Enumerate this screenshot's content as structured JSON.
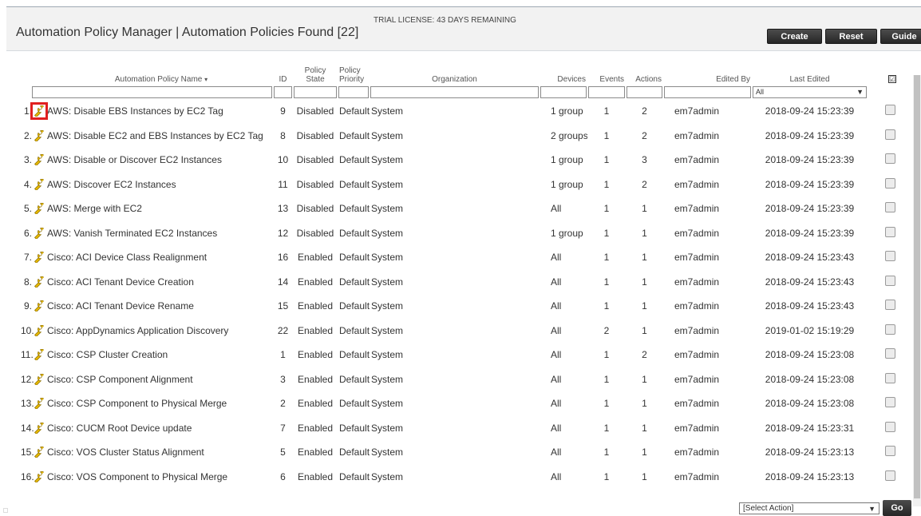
{
  "header": {
    "title": "Automation Policy Manager | Automation Policies Found [22]",
    "license": "TRIAL LICENSE: 43 DAYS REMAINING",
    "buttons": {
      "create": "Create",
      "reset": "Reset",
      "guide": "Guide"
    }
  },
  "columns": {
    "name": "Automation Policy Name",
    "name_sort": "▾",
    "id": "ID",
    "state_1": "Policy",
    "state_2": "State",
    "priority_1": "Policy",
    "priority_2": "Priority",
    "organization": "Organization",
    "devices": "Devices",
    "events": "Events",
    "actions": "Actions",
    "edited_by": "Edited By",
    "last_edited": "Last Edited",
    "select_all": "☑"
  },
  "filters": {
    "last_edited_value": "All"
  },
  "rows": [
    {
      "n": "1.",
      "name": "AWS: Disable EBS Instances by EC2 Tag",
      "id": "9",
      "state": "Disabled",
      "priority": "Default",
      "org": "System",
      "devices": "1 group",
      "events": "1",
      "actions": "2",
      "editor": "em7admin",
      "edited": "2018-09-24 15:23:39"
    },
    {
      "n": "2.",
      "name": "AWS: Disable EC2 and EBS Instances by EC2 Tag",
      "id": "8",
      "state": "Disabled",
      "priority": "Default",
      "org": "System",
      "devices": "2 groups",
      "events": "1",
      "actions": "2",
      "editor": "em7admin",
      "edited": "2018-09-24 15:23:39"
    },
    {
      "n": "3.",
      "name": "AWS: Disable or Discover EC2 Instances",
      "id": "10",
      "state": "Disabled",
      "priority": "Default",
      "org": "System",
      "devices": "1 group",
      "events": "1",
      "actions": "3",
      "editor": "em7admin",
      "edited": "2018-09-24 15:23:39"
    },
    {
      "n": "4.",
      "name": "AWS: Discover EC2 Instances",
      "id": "11",
      "state": "Disabled",
      "priority": "Default",
      "org": "System",
      "devices": "1 group",
      "events": "1",
      "actions": "2",
      "editor": "em7admin",
      "edited": "2018-09-24 15:23:39"
    },
    {
      "n": "5.",
      "name": "AWS: Merge with EC2",
      "id": "13",
      "state": "Disabled",
      "priority": "Default",
      "org": "System",
      "devices": "All",
      "events": "1",
      "actions": "1",
      "editor": "em7admin",
      "edited": "2018-09-24 15:23:39"
    },
    {
      "n": "6.",
      "name": "AWS: Vanish Terminated EC2 Instances",
      "id": "12",
      "state": "Disabled",
      "priority": "Default",
      "org": "System",
      "devices": "1 group",
      "events": "1",
      "actions": "1",
      "editor": "em7admin",
      "edited": "2018-09-24 15:23:39"
    },
    {
      "n": "7.",
      "name": "Cisco: ACI Device Class Realignment",
      "id": "16",
      "state": "Enabled",
      "priority": "Default",
      "org": "System",
      "devices": "All",
      "events": "1",
      "actions": "1",
      "editor": "em7admin",
      "edited": "2018-09-24 15:23:43"
    },
    {
      "n": "8.",
      "name": "Cisco: ACI Tenant Device Creation",
      "id": "14",
      "state": "Enabled",
      "priority": "Default",
      "org": "System",
      "devices": "All",
      "events": "1",
      "actions": "1",
      "editor": "em7admin",
      "edited": "2018-09-24 15:23:43"
    },
    {
      "n": "9.",
      "name": "Cisco: ACI Tenant Device Rename",
      "id": "15",
      "state": "Enabled",
      "priority": "Default",
      "org": "System",
      "devices": "All",
      "events": "1",
      "actions": "1",
      "editor": "em7admin",
      "edited": "2018-09-24 15:23:43"
    },
    {
      "n": "10.",
      "name": "Cisco: AppDynamics Application Discovery",
      "id": "22",
      "state": "Enabled",
      "priority": "Default",
      "org": "System",
      "devices": "All",
      "events": "2",
      "actions": "1",
      "editor": "em7admin",
      "edited": "2019-01-02 15:19:29"
    },
    {
      "n": "11.",
      "name": "Cisco: CSP Cluster Creation",
      "id": "1",
      "state": "Enabled",
      "priority": "Default",
      "org": "System",
      "devices": "All",
      "events": "1",
      "actions": "2",
      "editor": "em7admin",
      "edited": "2018-09-24 15:23:08"
    },
    {
      "n": "12.",
      "name": "Cisco: CSP Component Alignment",
      "id": "3",
      "state": "Enabled",
      "priority": "Default",
      "org": "System",
      "devices": "All",
      "events": "1",
      "actions": "1",
      "editor": "em7admin",
      "edited": "2018-09-24 15:23:08"
    },
    {
      "n": "13.",
      "name": "Cisco: CSP Component to Physical Merge",
      "id": "2",
      "state": "Enabled",
      "priority": "Default",
      "org": "System",
      "devices": "All",
      "events": "1",
      "actions": "1",
      "editor": "em7admin",
      "edited": "2018-09-24 15:23:08"
    },
    {
      "n": "14.",
      "name": "Cisco: CUCM Root Device update",
      "id": "7",
      "state": "Enabled",
      "priority": "Default",
      "org": "System",
      "devices": "All",
      "events": "1",
      "actions": "1",
      "editor": "em7admin",
      "edited": "2018-09-24 15:23:31"
    },
    {
      "n": "15.",
      "name": "Cisco: VOS Cluster Status Alignment",
      "id": "5",
      "state": "Enabled",
      "priority": "Default",
      "org": "System",
      "devices": "All",
      "events": "1",
      "actions": "1",
      "editor": "em7admin",
      "edited": "2018-09-24 15:23:13"
    },
    {
      "n": "16.",
      "name": "Cisco: VOS Component to Physical Merge",
      "id": "6",
      "state": "Enabled",
      "priority": "Default",
      "org": "System",
      "devices": "All",
      "events": "1",
      "actions": "1",
      "editor": "em7admin",
      "edited": "2018-09-24 15:23:13"
    }
  ],
  "footer": {
    "action_select": "[Select Action]",
    "go": "Go"
  },
  "colors": {
    "highlight": "#e02020",
    "button": "#333333",
    "wrench": "#e6b800"
  },
  "icons": {
    "edit": "wrench-icon",
    "dropdown": "chevron-down-icon"
  }
}
